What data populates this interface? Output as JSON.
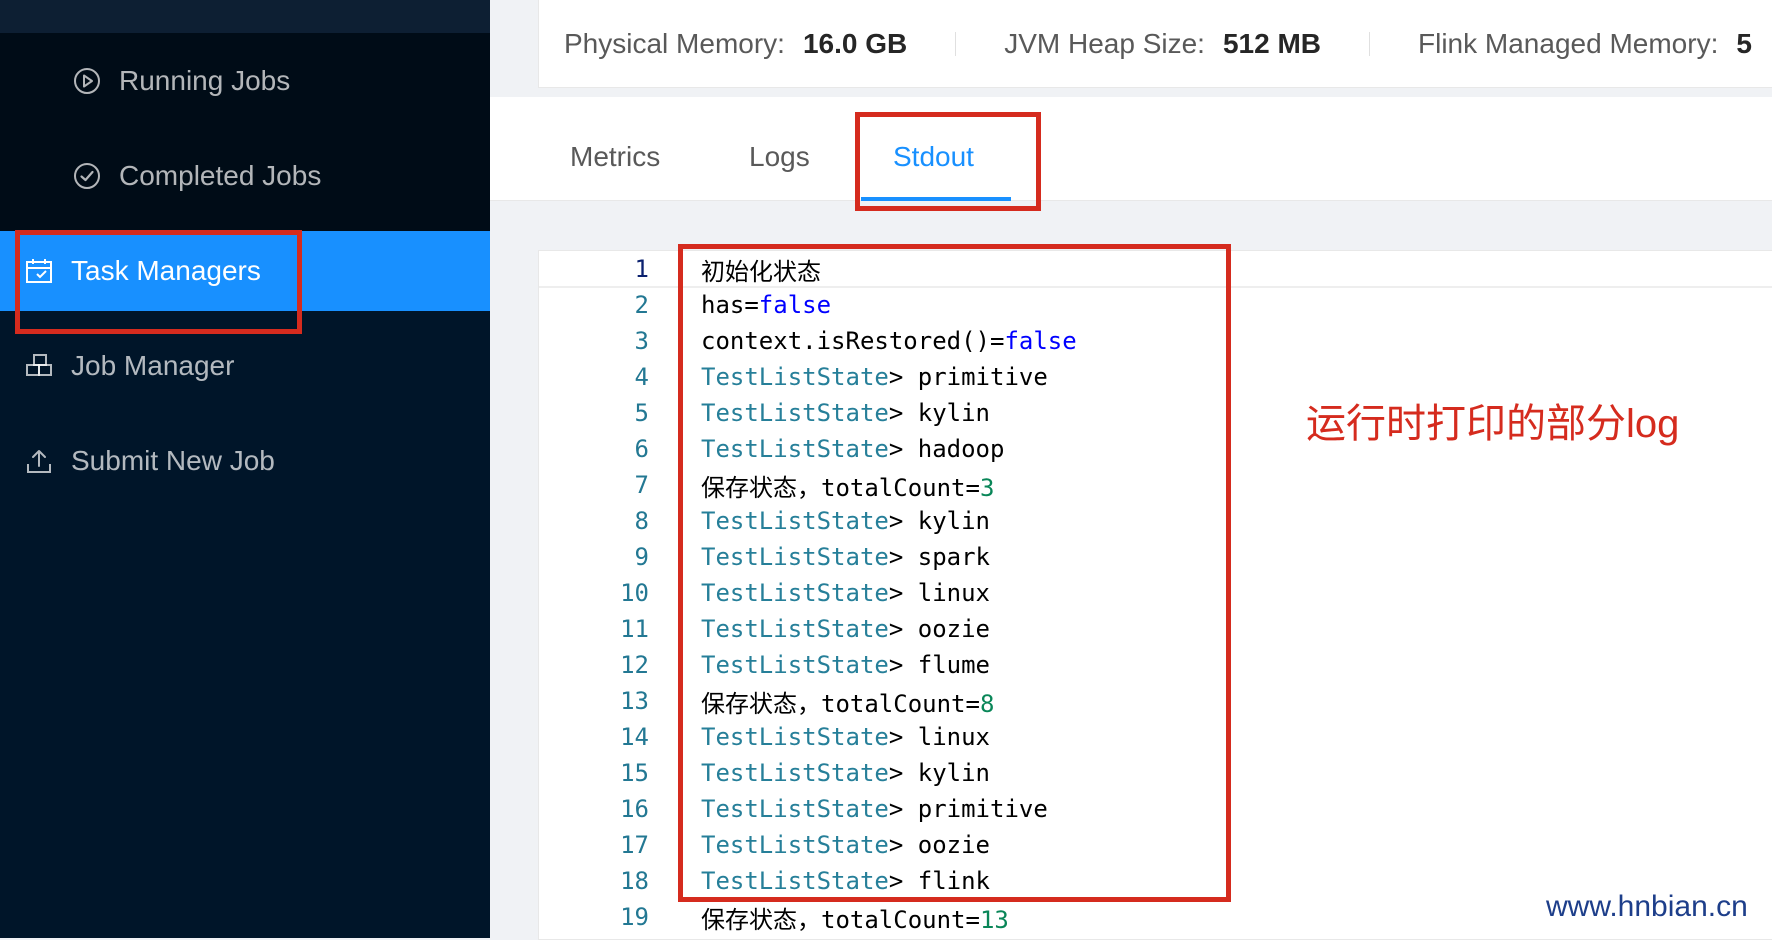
{
  "sidebar": {
    "items": [
      {
        "label": "Running Jobs",
        "icon": "play-circle-icon"
      },
      {
        "label": "Completed Jobs",
        "icon": "check-circle-icon"
      },
      {
        "label": "Task Managers",
        "icon": "calendar-icon"
      },
      {
        "label": "Job Manager",
        "icon": "build-icon"
      },
      {
        "label": "Submit New Job",
        "icon": "upload-icon"
      }
    ]
  },
  "stats": [
    {
      "label": "Physical Memory:",
      "value": "16.0 GB"
    },
    {
      "label": "JVM Heap Size:",
      "value": "512 MB"
    },
    {
      "label": "Flink Managed Memory:",
      "value": "5"
    }
  ],
  "tabs": [
    "Metrics",
    "Logs",
    "Stdout"
  ],
  "stdout": {
    "lines": [
      {
        "n": "1",
        "text": "初始化状态"
      },
      {
        "n": "2",
        "pre": "has=",
        "kw": "false"
      },
      {
        "n": "3",
        "pre": "context.isRestored()=",
        "kw": "false"
      },
      {
        "n": "4",
        "cls": "TestListState",
        "rest": "> primitive"
      },
      {
        "n": "5",
        "cls": "TestListState",
        "rest": "> kylin"
      },
      {
        "n": "6",
        "cls": "TestListState",
        "rest": "> hadoop"
      },
      {
        "n": "7",
        "pre": "保存状态，totalCount=",
        "num": "3"
      },
      {
        "n": "8",
        "cls": "TestListState",
        "rest": "> kylin"
      },
      {
        "n": "9",
        "cls": "TestListState",
        "rest": "> spark"
      },
      {
        "n": "10",
        "cls": "TestListState",
        "rest": "> linux"
      },
      {
        "n": "11",
        "cls": "TestListState",
        "rest": "> oozie"
      },
      {
        "n": "12",
        "cls": "TestListState",
        "rest": "> flume"
      },
      {
        "n": "13",
        "pre": "保存状态，totalCount=",
        "num": "8"
      },
      {
        "n": "14",
        "cls": "TestListState",
        "rest": "> linux"
      },
      {
        "n": "15",
        "cls": "TestListState",
        "rest": "> kylin"
      },
      {
        "n": "16",
        "cls": "TestListState",
        "rest": "> primitive"
      },
      {
        "n": "17",
        "cls": "TestListState",
        "rest": "> oozie"
      },
      {
        "n": "18",
        "cls": "TestListState",
        "rest": "> flink"
      },
      {
        "n": "19",
        "pre": "保存状态，totalCount=",
        "num": "13"
      }
    ]
  },
  "annotation": {
    "note": "运行时打印的部分log"
  },
  "watermark": "www.hnbian.cn",
  "colors": {
    "sidebar_bg": "#001529",
    "active": "#1890ff",
    "annotation_red": "#d52b1e"
  }
}
